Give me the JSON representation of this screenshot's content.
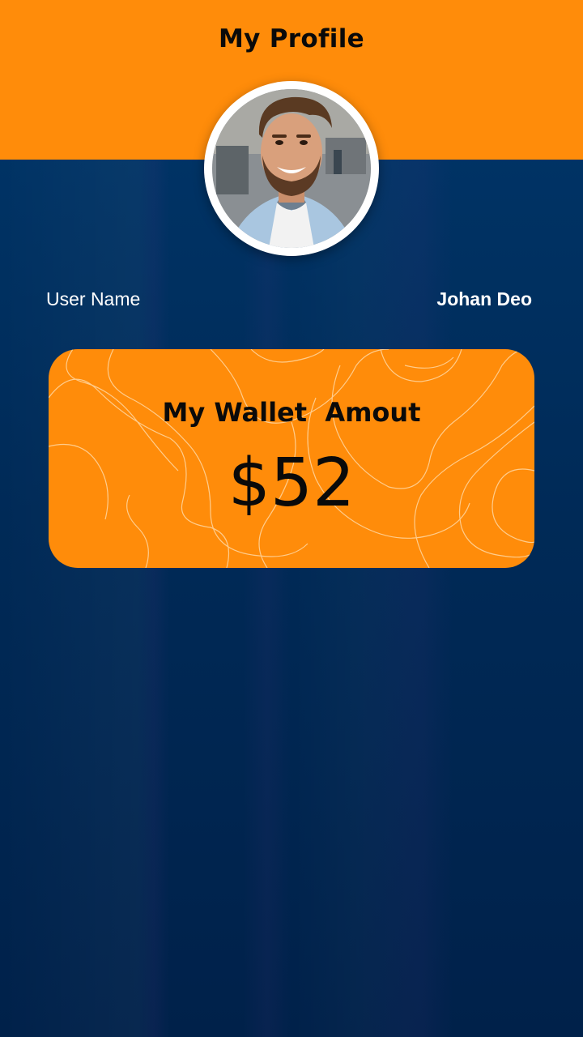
{
  "header": {
    "title": "My Profile",
    "background_color": "#ff8c0a"
  },
  "profile": {
    "avatar_icon": "user-avatar-photo",
    "username_label": "User Name",
    "username_value": "Johan Deo"
  },
  "wallet": {
    "title": "My Wallet  Amout",
    "amount": "$52",
    "card_color": "#ff8c0a"
  },
  "colors": {
    "page_background": "#002a57",
    "text_light": "#ffffff",
    "text_dark": "#0a0a0a"
  }
}
